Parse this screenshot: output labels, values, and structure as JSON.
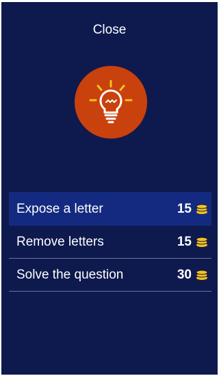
{
  "dialog": {
    "close_label": "Close",
    "hint_icon": "lightbulb-icon",
    "accent_color": "#c9410d",
    "options": [
      {
        "label": "Expose a letter",
        "price": "15",
        "icon": "coins-icon",
        "selected": true
      },
      {
        "label": "Remove letters",
        "price": "15",
        "icon": "coins-icon",
        "selected": false
      },
      {
        "label": "Solve the question",
        "price": "30",
        "icon": "coins-icon",
        "selected": false
      }
    ]
  }
}
